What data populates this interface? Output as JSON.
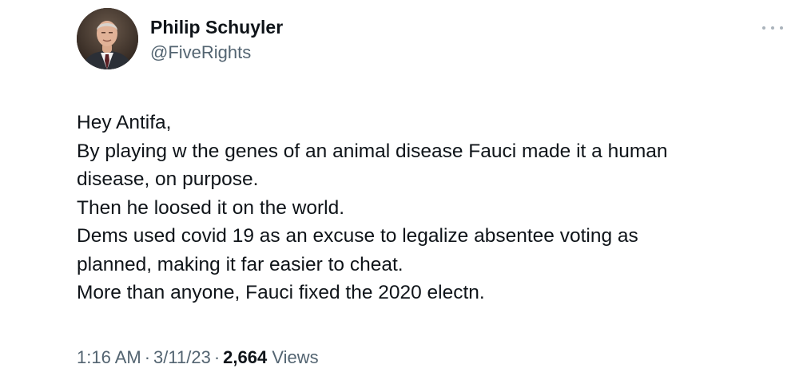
{
  "author": {
    "name": "Philip Schuyler",
    "handle": "@FiveRights"
  },
  "tweet": {
    "lines": [
      "Hey Antifa,",
      "By playing w the genes of an animal disease Fauci made it a human",
      "disease, on purpose.",
      "Then he loosed it on the world.",
      "Dems used covid 19 as an excuse to legalize absentee voting as",
      "planned, making it far easier to cheat.",
      "More than anyone, Fauci fixed the 2020 electn."
    ],
    "time": "1:16 AM",
    "date": "3/11/23",
    "separator": "·",
    "views_count": "2,664",
    "views_label": "Views"
  },
  "icons": {
    "avatar": "profile-photo",
    "more": "more-options-icon"
  }
}
